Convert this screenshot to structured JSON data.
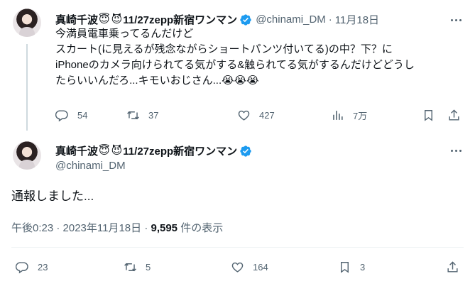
{
  "tweet1": {
    "display_name": "真崎千波",
    "emoji_angel": "😇",
    "emoji_devil": "😈",
    "name_suffix": "11/27zepp新宿ワンマン",
    "handle": "@chinami_DM",
    "separator": "·",
    "date": "11月18日",
    "text_lines": [
      "今満員電車乗ってるんだけど",
      "スカート(に見えるが残念ながらショートパンツ付いてる)の中？下？に",
      "iPhoneのカメラ向けられてる気がする&触られてる気がするんだけどどうし",
      "たらいいんだろ...キモいおじさん...😭😭😭"
    ],
    "replies": "54",
    "retweets": "37",
    "likes": "427",
    "views": "7万"
  },
  "tweet2": {
    "display_name": "真崎千波",
    "emoji_angel": "😇",
    "emoji_devil": "😈",
    "name_suffix": "11/27zepp新宿ワンマン",
    "handle": "@chinami_DM",
    "text": "通報しました...",
    "timestamp": "午後0:23 · 2023年11月18日 · ",
    "view_count": "9,595",
    "view_label": " 件の表示",
    "replies": "23",
    "retweets": "5",
    "likes": "164",
    "bookmarks": "3"
  },
  "colors": {
    "verified": "#1d9bf0",
    "text_primary": "#0f1419",
    "text_secondary": "#536471",
    "divider": "#eff3f4"
  },
  "icons": [
    "verified-badge-icon",
    "more-icon",
    "reply-icon",
    "retweet-icon",
    "like-icon",
    "views-icon",
    "bookmark-icon",
    "share-icon"
  ]
}
